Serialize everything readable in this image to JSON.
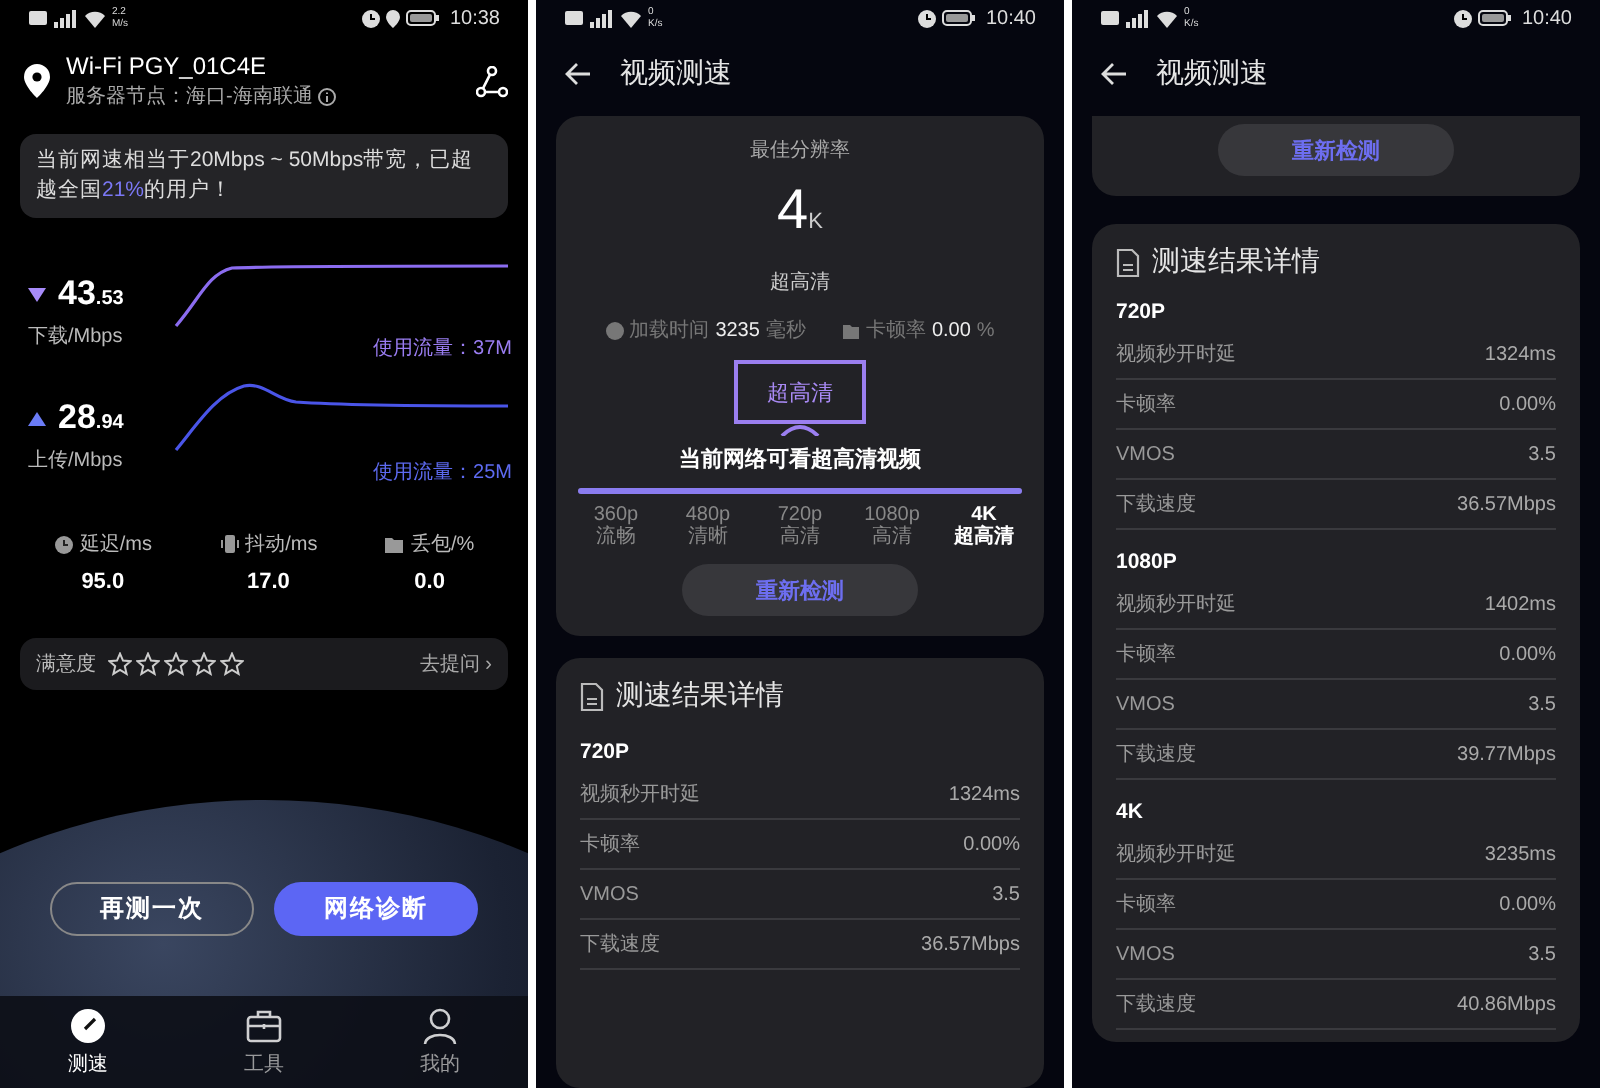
{
  "speed_test": {
    "status_bar": {
      "net_speed": "2.2",
      "net_unit": "M/s",
      "time": "10:38"
    },
    "network": {
      "name": "Wi-Fi PGY_01C4E",
      "server": "服务器节点：海口-海南联通"
    },
    "notice": "当前网速相当于20Mbps ~ 50Mbps带宽，已超越全国**21%**的用户！",
    "speeds": [
      {
        "kind": "download",
        "whole": "43",
        "fraction": ".53",
        "label": "下载/Mbps",
        "usage": "使用流量：37M"
      },
      {
        "kind": "upload",
        "whole": "28",
        "fraction": ".94",
        "label": "上传/Mbps",
        "usage": "使用流量：25M"
      }
    ],
    "metrics": [
      {
        "kind": "latency",
        "label": "延迟/ms",
        "value": "95.0"
      },
      {
        "kind": "jitter",
        "label": "抖动/ms",
        "value": "17.0"
      },
      {
        "kind": "loss",
        "label": "丢包/%",
        "value": "0.0"
      }
    ],
    "rating": {
      "label": "满意度",
      "stars": 0,
      "link": "去提问 ›"
    },
    "buttons": [
      {
        "kind": "outline",
        "label": "再测一次"
      },
      {
        "kind": "primary",
        "label": "网络诊断"
      }
    ],
    "nav": [
      {
        "kind": "speed",
        "label": "测速",
        "selected": true
      },
      {
        "kind": "tools",
        "label": "工具",
        "selected": false
      },
      {
        "kind": "profile",
        "label": "我的",
        "selected": false
      }
    ]
  },
  "video_test": {
    "status_bar": {
      "net_speed": "0",
      "net_unit": "K/s",
      "time": "10:40"
    },
    "title": "视频测速",
    "best": {
      "caption": "最佳分辨率",
      "value": "4",
      "unit": "K",
      "quality": "超高清"
    },
    "stats": [
      {
        "kind": "load",
        "label": "加载时间",
        "value": "3235",
        "unit": "毫秒"
      },
      {
        "kind": "stall",
        "label": "卡顿率",
        "value": "0.00",
        "unit": "%"
      }
    ],
    "tv_label": "超高清",
    "message": "当前网络可看超高清视频",
    "level": 1,
    "resolutions": [
      {
        "label": "360p",
        "quality": "流畅",
        "selected": false
      },
      {
        "label": "480p",
        "quality": "清晰",
        "selected": false
      },
      {
        "label": "720p",
        "quality": "高清",
        "selected": false
      },
      {
        "label": "1080p",
        "quality": "高清",
        "selected": false
      },
      {
        "label": "4K",
        "quality": "超高清",
        "selected": true
      }
    ],
    "retest": "重新检测",
    "details": {
      "title": "测速结果详情",
      "groups": [
        {
          "name": "720P",
          "rows": [
            {
              "label": "视频秒开时延",
              "value": "1324ms"
            },
            {
              "label": "卡顿率",
              "value": "0.00%"
            },
            {
              "label": "VMOS",
              "value": "3.5"
            },
            {
              "label": "下载速度",
              "value": "36.57Mbps"
            }
          ]
        }
      ]
    }
  },
  "video_results": {
    "status_bar": {
      "net_speed": "0",
      "net_unit": "K/s",
      "time": "10:40"
    },
    "title": "视频测速",
    "retest": "重新检测",
    "details": {
      "title": "测速结果详情",
      "groups": [
        {
          "name": "720P",
          "rows": [
            {
              "label": "视频秒开时延",
              "value": "1324ms"
            },
            {
              "label": "卡顿率",
              "value": "0.00%"
            },
            {
              "label": "VMOS",
              "value": "3.5"
            },
            {
              "label": "下载速度",
              "value": "36.57Mbps"
            }
          ]
        },
        {
          "name": "1080P",
          "rows": [
            {
              "label": "视频秒开时延",
              "value": "1402ms"
            },
            {
              "label": "卡顿率",
              "value": "0.00%"
            },
            {
              "label": "VMOS",
              "value": "3.5"
            },
            {
              "label": "下载速度",
              "value": "39.77Mbps"
            }
          ]
        },
        {
          "name": "4K",
          "rows": [
            {
              "label": "视频秒开时延",
              "value": "3235ms"
            },
            {
              "label": "卡顿率",
              "value": "0.00%"
            },
            {
              "label": "VMOS",
              "value": "3.5"
            },
            {
              "label": "下载速度",
              "value": "40.86Mbps"
            }
          ]
        }
      ]
    }
  }
}
